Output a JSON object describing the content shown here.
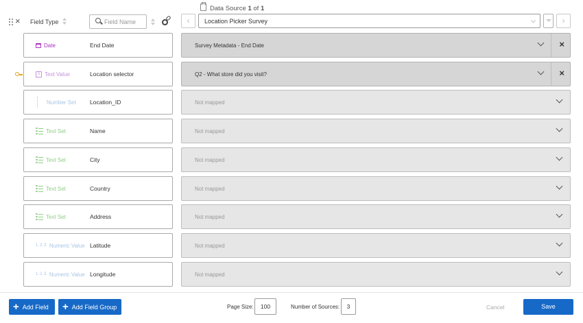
{
  "header": {
    "field_type_label": "Field Type",
    "search_placeholder": "Field Name",
    "data_source_prefix": "Data Source",
    "data_source_current": "1",
    "data_source_of": "of",
    "data_source_total": "1",
    "source_selected": "Location Picker Survey",
    "prev_glyph": "‹",
    "next_glyph": "›",
    "select_chevron": "⌵"
  },
  "icons": {
    "drag": "drag-handle-icon",
    "remove": "close-icon",
    "search": "search-icon",
    "settings": "gear-link-icon",
    "data_source": "clipboard-icon",
    "key": "key-icon"
  },
  "colors": {
    "date": "#a72ec0",
    "text_value": "#c391d8",
    "number_set": "#a8c5e6",
    "text_set": "#8fce86",
    "numeric_value": "#a8c5e6",
    "accent": "#1769c7"
  },
  "fields": [
    {
      "type_label": "Date",
      "type_icon": "calendar-icon",
      "type_color": "#a72ec0",
      "name": "End Date",
      "mapping": "Survey Metadata - End Date",
      "mapped": true,
      "key": false
    },
    {
      "type_label": "Text Value",
      "type_icon": "text-value-icon",
      "type_color": "#c391d8",
      "name": "Location selector",
      "mapping": "Q2 - What store did you visit?",
      "mapped": true,
      "key": true
    },
    {
      "type_label": "Number Set",
      "type_icon": "number-set-icon",
      "type_color": "#a8c5e6",
      "name": "Location_ID",
      "mapping": "Not mapped",
      "mapped": false,
      "key": false
    },
    {
      "type_label": "Text Set",
      "type_icon": "text-set-icon",
      "type_color": "#8fce86",
      "name": "Name",
      "mapping": "Not mapped",
      "mapped": false,
      "key": false
    },
    {
      "type_label": "Text Set",
      "type_icon": "text-set-icon",
      "type_color": "#8fce86",
      "name": "City",
      "mapping": "Not mapped",
      "mapped": false,
      "key": false
    },
    {
      "type_label": "Text Set",
      "type_icon": "text-set-icon",
      "type_color": "#8fce86",
      "name": "Country",
      "mapping": "Not mapped",
      "mapped": false,
      "key": false
    },
    {
      "type_label": "Text Set",
      "type_icon": "text-set-icon",
      "type_color": "#8fce86",
      "name": "Address",
      "mapping": "Not mapped",
      "mapped": false,
      "key": false
    },
    {
      "type_label": "Numeric Value",
      "type_icon": "numeric-value-icon",
      "type_color": "#a8c5e6",
      "name": "Latitude",
      "mapping": "Not mapped",
      "mapped": false,
      "key": false
    },
    {
      "type_label": "Numeric Value",
      "type_icon": "numeric-value-icon",
      "type_color": "#a8c5e6",
      "name": "Longitude",
      "mapping": "Not mapped",
      "mapped": false,
      "key": false
    }
  ],
  "footer": {
    "add_field": "Add Field",
    "add_field_group": "Add Field Group",
    "plus_glyph": "+",
    "page_size_label": "Page Size:",
    "page_size_value": "100",
    "num_sources_label": "Number of Sources:",
    "num_sources_value": "3",
    "cancel": "Cancel",
    "save": "Save"
  }
}
